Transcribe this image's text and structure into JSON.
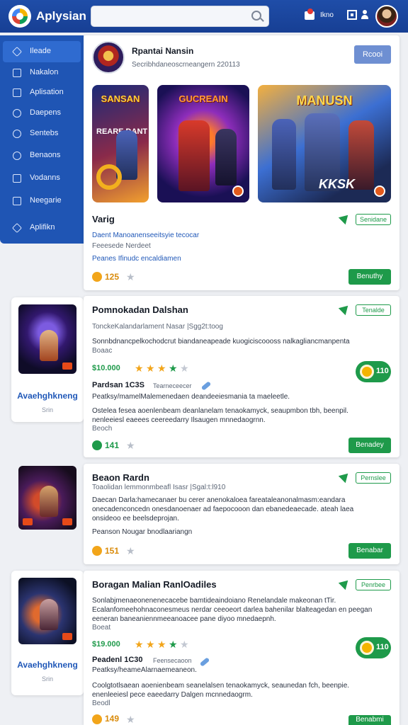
{
  "app": {
    "title": "Aplysian"
  },
  "header": {
    "notif_label": "Ikno"
  },
  "icons": {
    "logo": "pinwheel-logo",
    "search": "search-icon",
    "notif": "bag-icon",
    "grid": "grid-icon",
    "user": "user-icon"
  },
  "colors": {
    "header": "#1f4da8",
    "sidebar": "#1f55b4",
    "accent": "#1e9a4a",
    "link": "#2058b8"
  },
  "sidebar": {
    "items": [
      {
        "label": "Ileade",
        "active": true
      },
      {
        "label": "Nakalon"
      },
      {
        "label": "Aplisation"
      },
      {
        "label": "Daepens"
      },
      {
        "label": "Sentebs"
      },
      {
        "label": "Benaons"
      },
      {
        "label": "Vodanns"
      },
      {
        "label": "Neegarie"
      },
      {
        "label": "Aplifikn"
      }
    ]
  },
  "featured": {
    "title": "Rpantai Nansin",
    "subtitle": "Secribhdaneoscrneangern 220113",
    "open_label": "Rcooi",
    "shots": [
      "SANSAN",
      "GUCREAIN",
      "MANUSN"
    ],
    "shot_sub": [
      "REARE DANT",
      "",
      "KKSK"
    ],
    "name": "Varig",
    "tag": "Senidane",
    "link1": "Daent  Manoanenseeitsyie tecocar",
    "meta1": "Feeesede Nerdeet",
    "link2": "Peanes  Ifinudc encaldiamen",
    "count": "125",
    "button": "Benuthy"
  },
  "apps": [
    {
      "thumb_caption": "Avaehghkneng",
      "thumb_sub": "Srin",
      "title": "Pomnokadan Dalshan",
      "tag": "Tenalde",
      "meta": "TonckeKalandarlament  Nasar  |Sgg2t:toog",
      "desc": "Sonnbdnancpelkochodcrut biandaneapeade kuogiciscoooss nalkagliancmanpenta",
      "desc2": "Boaac",
      "price": "$10.000",
      "stars": 4,
      "pill": "110",
      "sub_title": "Pardsan  1C3S",
      "sub_note": "Tearneceecer",
      "sub_desc": "Peatksy/mamelMalemenedaen deandeeiesmania ta maeleetle.",
      "para": "Ostelea fesea aoenlenbeam deanlanelam tenaokamyck, seaupmbon tbh, beenpil.",
      "para2": "nenleeiesl eaeees ceereedarry Ilsaugen mnnedaogrnn.",
      "para3": "Beoch",
      "count": "141",
      "button": "Benadey"
    },
    {
      "title": "Beaon Rardn",
      "tag": "Pernslee",
      "meta": "Toaolidan lemmonmbeafl  Isasr  |Sgal:t:l910",
      "desc": "Daecan  Darla:hamecanaer bu cerer anenokaloea fareataleanonalmasm:eandara",
      "desc2": "onecadenconcedn onesdanoenaer ad faepocooon dan ebanedeaecade. ateah laea",
      "desc3": "onsideoo ee beelsdeprojan.",
      "link": "Peanson  Nougar bnodlaariangn",
      "count": "151",
      "button": "Benabar"
    },
    {
      "thumb_caption": "Avaehghkneng",
      "thumb_sub": "Srin",
      "title": "Boragan Malian RanlOadiles",
      "tag": "Penrbee",
      "desc": "Sonlabjmenaeonenenecacebe bamtideaindoiano  Renelandale makeonan tTir.",
      "desc2": "Ecalanfomeehohnaconesmeus nerdar ceeoeort darlea bahenilar blalteagedan en peegan",
      "desc3": "eeneran baneaniennmeeanoacee pane diyoo mnedaepnh.",
      "desc4": "Boeat",
      "price": "$19.000",
      "stars": 4,
      "pill": "110",
      "sub_title": "Peadenl  1C30",
      "sub_note": "Feensecaoon",
      "sub_desc": "Peatksy/heameAlarnaemeaneon.",
      "para": "Coolgtotlsaean aoenienbeam seanelalsen tenaokamyck, seaunedan fch, beenpie.",
      "para2": "enenleeiesl pece eaeedarry Dalgen mcnnedaogrm.",
      "para3": "Beodl",
      "count": "149",
      "button": "Benabmi"
    }
  ]
}
